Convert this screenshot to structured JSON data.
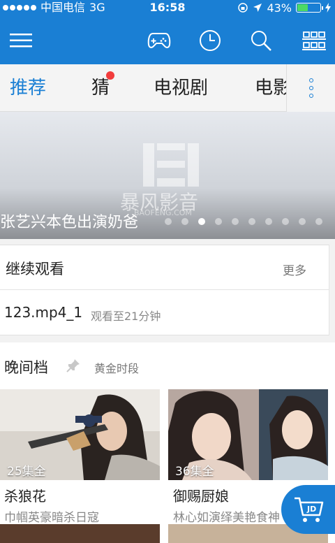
{
  "status": {
    "carrier": "中国电信",
    "network": "3G",
    "time": "16:58",
    "battery": "43%",
    "battery_level": 0.43
  },
  "nav": {
    "icons": [
      "menu-icon",
      "gamepad-icon",
      "history-icon",
      "search-icon",
      "grid-icon"
    ]
  },
  "tabs": {
    "items": [
      {
        "label": "推荐",
        "active": true
      },
      {
        "label": "猜",
        "badge": true
      },
      {
        "label": "电视剧"
      },
      {
        "label": "电影"
      }
    ]
  },
  "banner": {
    "caption": "张艺兴本色出演奶爸",
    "watermark": "暴风影音",
    "watermark_sub": "BAOFENG.COM",
    "page_count": 10,
    "active_page": 3
  },
  "continue": {
    "title": "继续观看",
    "more": "更多",
    "file": "123.mp4_1",
    "progress_text": "观看至21分钟"
  },
  "evening": {
    "title": "晚间档",
    "subtitle": "黄金时段",
    "items": [
      {
        "episodes": "25集全",
        "title": "杀狼花",
        "desc": "巾帼英豪暗杀日寇"
      },
      {
        "episodes": "36集全",
        "title": "御赐厨娘",
        "desc": "林心如演绎美艳食神"
      }
    ]
  },
  "colors": {
    "accent": "#1a7fd4",
    "badge": "#f23c3c"
  }
}
